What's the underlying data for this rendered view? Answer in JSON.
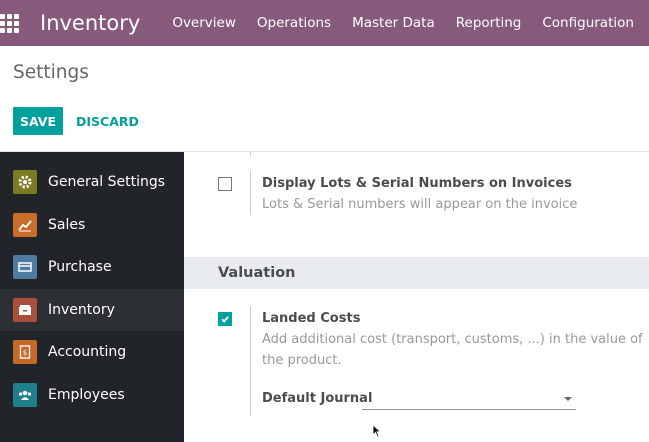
{
  "navbar": {
    "app_name": "Inventory",
    "menu": [
      "Overview",
      "Operations",
      "Master Data",
      "Reporting",
      "Configuration"
    ]
  },
  "control_panel": {
    "breadcrumb": "Settings",
    "save_label": "SAVE",
    "discard_label": "DISCARD"
  },
  "sidebar": {
    "items": [
      {
        "label": "General Settings",
        "icon": "gear-icon",
        "color": "#7c7b24"
      },
      {
        "label": "Sales",
        "icon": "chart-icon",
        "color": "#c86d2c"
      },
      {
        "label": "Purchase",
        "icon": "card-icon",
        "color": "#4f7ba0"
      },
      {
        "label": "Inventory",
        "icon": "box-icon",
        "color": "#a8503b"
      },
      {
        "label": "Accounting",
        "icon": "invoice-icon",
        "color": "#c8692a"
      },
      {
        "label": "Employees",
        "icon": "people-icon",
        "color": "#1f7f8c"
      }
    ],
    "active": "Inventory"
  },
  "main": {
    "lots_setting": {
      "title": "Display Lots & Serial Numbers on Invoices",
      "description": "Lots & Serial numbers will appear on the invoice",
      "checked": false
    },
    "section_title": "Valuation",
    "landed_costs": {
      "title": "Landed Costs",
      "description": "Add additional cost (transport, customs, ...) in the value of the product.",
      "checked": true,
      "field_label": "Default Journal",
      "field_value": ""
    }
  },
  "colors": {
    "navbar": "#875a7b",
    "accent": "#00a09d",
    "sidebar": "#212529"
  }
}
